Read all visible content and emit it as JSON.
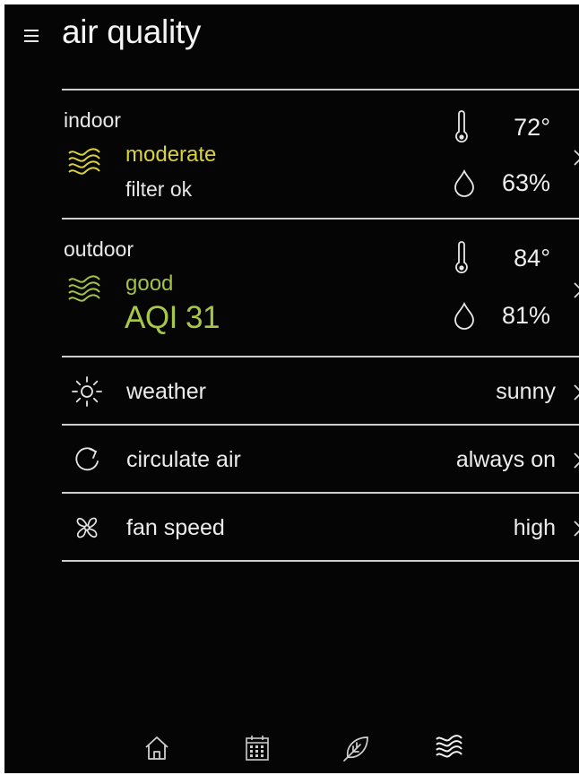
{
  "header": {
    "title": "air quality",
    "menu_icon": "hamburger-menu-icon"
  },
  "indoor": {
    "label": "indoor",
    "status": "moderate",
    "filter": "filter ok",
    "temperature": "72°",
    "humidity": "63%",
    "status_color": "#d9d23c"
  },
  "outdoor": {
    "label": "outdoor",
    "status": "good",
    "aqi": "AQI 31",
    "temperature": "84°",
    "humidity": "81%",
    "status_color": "#a4c24a"
  },
  "settings": [
    {
      "icon": "sun-icon",
      "label": "weather",
      "value": "sunny"
    },
    {
      "icon": "circulate-icon",
      "label": "circulate air",
      "value": "always on"
    },
    {
      "icon": "fan-icon",
      "label": "fan speed",
      "value": "high"
    }
  ],
  "bottom_nav": [
    {
      "icon": "home-icon",
      "active": false
    },
    {
      "icon": "calendar-icon",
      "active": false
    },
    {
      "icon": "leaf-icon",
      "active": false
    },
    {
      "icon": "air-quality-icon",
      "active": true
    }
  ]
}
